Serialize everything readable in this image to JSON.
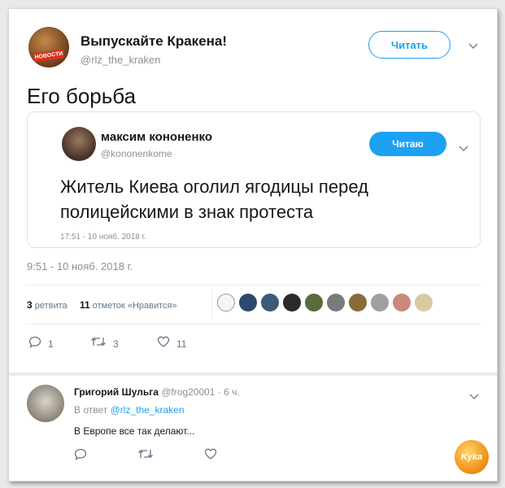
{
  "tweet": {
    "author_name": "Выпускайте Кракена!",
    "author_handle": "@rlz_the_kraken",
    "avatar_tag": "НОВОСТИ",
    "follow_label": "Читать",
    "text": "Его борьба",
    "time": "9:51 - 10 нояб. 2018 г."
  },
  "quote": {
    "author_name": "максим кононенко",
    "author_handle": "@kononenkome",
    "follow_label": "Читаю",
    "text": "Житель Киева оголил ягодицы перед полицейскими в знак протеста",
    "time": "17:51 - 10 нояб. 2018 г."
  },
  "stats": {
    "retweets_count": "3",
    "retweets_label": "ретвита",
    "likes_count": "11",
    "likes_label": "отметок «Нравится»"
  },
  "actions": {
    "reply_count": "1",
    "retweet_count": "3",
    "like_count": "11"
  },
  "reply": {
    "author_name": "Григорий Шульга",
    "author_handle": "@frog20001",
    "time": "6 ч.",
    "in_reply_prefix": "В ответ",
    "in_reply_handle": "@rlz_the_kraken",
    "text": "В Европе все так делают..."
  },
  "watermark": "Kyka",
  "colors": {
    "accent": "#1da1f2",
    "muted": "#8a9199"
  }
}
